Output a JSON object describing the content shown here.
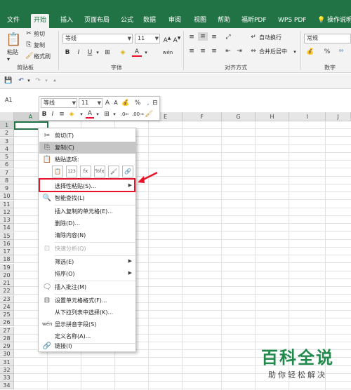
{
  "tabs": [
    "文件",
    "开始",
    "插入",
    "页面布局",
    "公式",
    "数据",
    "审阅",
    "视图",
    "帮助",
    "福昕PDF",
    "WPS PDF",
    "操作说明"
  ],
  "active_tab": "开始",
  "ribbon": {
    "clipboard": {
      "paste": "粘贴",
      "cut": "剪切",
      "copy": "复制",
      "format_painter": "格式刷",
      "group": "剪贴板"
    },
    "font": {
      "name": "等线",
      "size": "11",
      "group": "字体",
      "bold": "B",
      "italic": "I",
      "underline": "U"
    },
    "alignment": {
      "wrap": "自动换行",
      "merge": "合并后居中",
      "group": "对齐方式"
    },
    "number": {
      "format": "常规",
      "group": "数字"
    }
  },
  "formula_bar": {
    "name_box": "A1"
  },
  "mini_toolbar": {
    "font": "等线",
    "size": "11"
  },
  "columns": [
    "A",
    "B",
    "C",
    "D",
    "E",
    "F",
    "G",
    "H",
    "I",
    "J"
  ],
  "rows": [
    "1",
    "2",
    "3",
    "4",
    "5",
    "6",
    "7",
    "8",
    "9",
    "10",
    "11",
    "12",
    "13",
    "14",
    "15",
    "16",
    "17",
    "18",
    "19",
    "20",
    "21",
    "22",
    "23",
    "24",
    "25",
    "26",
    "27",
    "28",
    "29",
    "30",
    "31",
    "32",
    "33",
    "34"
  ],
  "context_menu": {
    "cut": "剪切(T)",
    "copy": "复制(C)",
    "paste_options": "粘贴选项:",
    "paste_special": "选择性粘贴(S)...",
    "smart_lookup": "智能查找(L)",
    "insert_copied": "插入复制的单元格(E)...",
    "delete": "删除(D)...",
    "clear": "清除内容(N)",
    "quick_analysis": "快速分析(Q)",
    "filter": "筛选(E)",
    "sort": "排序(O)",
    "insert_comment": "插入批注(M)",
    "format_cells": "设置单元格格式(F)...",
    "pick_list": "从下拉列表中选择(K)...",
    "phonetic": "显示拼音字段(S)",
    "define_name": "定义名称(A)...",
    "link": "链接(I)"
  },
  "watermark": {
    "title": "百科全说",
    "subtitle": "助你轻松解决"
  },
  "colors": {
    "excel_green": "#217346",
    "highlight_red": "#e8132a"
  }
}
